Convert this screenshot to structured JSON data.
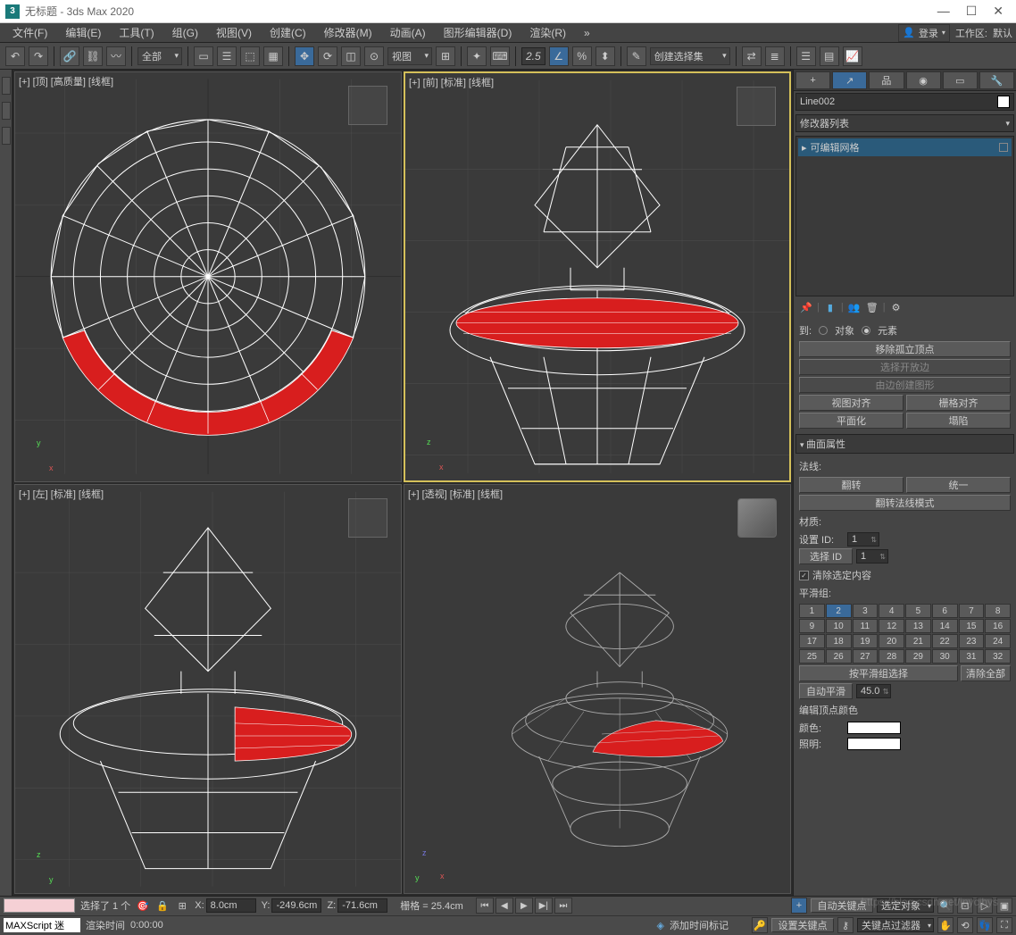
{
  "title": "无标题 - 3ds Max 2020",
  "menubar": {
    "items": [
      "文件(F)",
      "编辑(E)",
      "工具(T)",
      "组(G)",
      "视图(V)",
      "创建(C)",
      "修改器(M)",
      "动画(A)",
      "图形编辑器(D)",
      "渲染(R)"
    ],
    "login": "登录",
    "workspace_label": "工作区:",
    "workspace_value": "默认"
  },
  "toolbar": {
    "filter": "全部",
    "view_mode": "视图",
    "transform_num": "2.5",
    "selection_set": "创建选择集"
  },
  "viewports": {
    "top": {
      "label": "[+] [顶] [高质量] [线框]"
    },
    "front": {
      "label": "[+] [前] [标准] [线框]"
    },
    "left": {
      "label": "[+] [左] [标准] [线框]"
    },
    "persp": {
      "label": "[+] [透视] [标准] [线框]"
    }
  },
  "panel": {
    "object_name": "Line002",
    "modifier_list": "修改器列表",
    "mod_item": "可编辑网格",
    "to_label": "到:",
    "to_opt1": "对象",
    "to_opt2": "元素",
    "btn_remove_iso": "移除孤立顶点",
    "btn_select_open": "选择开放边",
    "btn_create_shape": "由边创建图形",
    "btn_view_align": "视图对齐",
    "btn_grid_align": "栅格对齐",
    "btn_planarize": "平面化",
    "btn_collapse": "塌陷",
    "rollout_surface": "曲面属性",
    "normals_label": "法线:",
    "btn_flip": "翻转",
    "btn_unify": "统一",
    "btn_flip_mode": "翻转法线模式",
    "material_label": "材质:",
    "set_id_label": "设置 ID:",
    "set_id_val": "1",
    "select_id_label": "选择 ID",
    "select_id_val": "1",
    "clear_selection": "清除选定内容",
    "smooth_groups_label": "平滑组:",
    "btn_select_by_sg": "按平滑组选择",
    "btn_clear_all": "清除全部",
    "auto_smooth": "自动平滑",
    "auto_smooth_val": "45.0",
    "edit_vertex_color": "编辑顶点颜色",
    "color_label": "颜色:",
    "illum_label": "照明:"
  },
  "smooth_grid": [
    "1",
    "2",
    "3",
    "4",
    "5",
    "6",
    "7",
    "8",
    "9",
    "10",
    "11",
    "12",
    "13",
    "14",
    "15",
    "16",
    "17",
    "18",
    "19",
    "20",
    "21",
    "22",
    "23",
    "24",
    "25",
    "26",
    "27",
    "28",
    "29",
    "30",
    "31",
    "32"
  ],
  "status": {
    "selection": "选择了 1 个",
    "x": "8.0cm",
    "y": "-249.6cm",
    "z": "-71.6cm",
    "grid": "栅格 = 25.4cm",
    "auto_key": "自动关键点",
    "selected_obj": "选定对象",
    "set_key": "设置关键点",
    "key_filter": "关键点过滤器",
    "maxscript": "MAXScript 迷",
    "render_time_label": "渲染时间",
    "render_time": "0:00:00",
    "add_time_tag": "添加时间标记"
  },
  "watermark": "https://blog.csdn.net/jnycjhys"
}
